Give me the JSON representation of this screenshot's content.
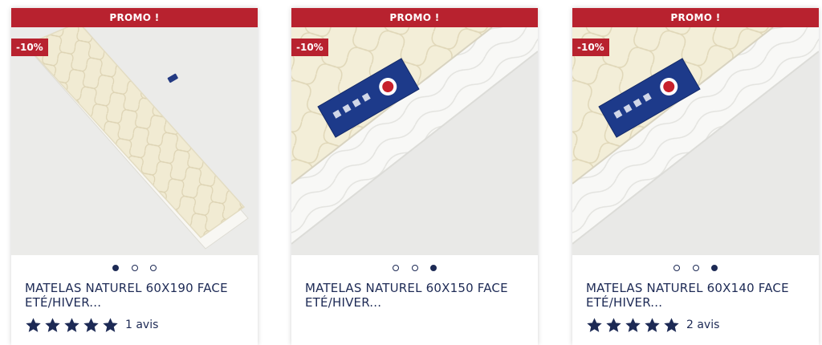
{
  "products": [
    {
      "banner": "PROMO !",
      "discount": "-10%",
      "title": "MATELAS NATUREL 60X190 FACE ETÉ/HIVER...",
      "rating_stars": 5,
      "reviews": "1 avis",
      "active_slide": 1,
      "slide_count": 3
    },
    {
      "banner": "PROMO !",
      "discount": "-10%",
      "title": "MATELAS NATUREL 60X150 FACE ETÉ/HIVER...",
      "rating_stars": 0,
      "reviews": "",
      "active_slide": 3,
      "slide_count": 3
    },
    {
      "banner": "PROMO !",
      "discount": "-10%",
      "title": "MATELAS NATUREL 60X140 FACE ETÉ/HIVER...",
      "rating_stars": 5,
      "reviews": "2 avis",
      "active_slide": 3,
      "slide_count": 3
    }
  ],
  "colors": {
    "promo": "#b8222f",
    "navy": "#1d2a55",
    "mattress": "#f3eedb",
    "mattress_base": "#f7f6f2"
  },
  "icons": {
    "rating": "star-icon",
    "carousel": "carousel-dot"
  }
}
